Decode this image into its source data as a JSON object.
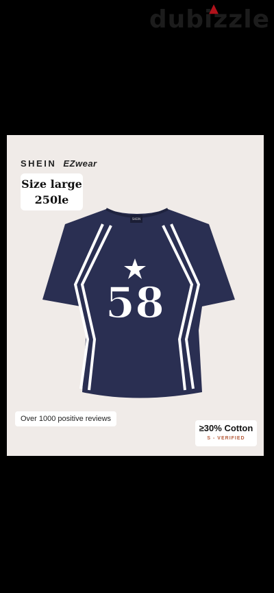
{
  "watermark": {
    "text": "dubizzle"
  },
  "product": {
    "brand": "SHEIN",
    "sub_brand": "EZwear",
    "size_text": "Size large",
    "price_text": "250le",
    "shirt_number": "58",
    "neck_label": "SHEIN",
    "colors": {
      "shirt": "#2a2f52",
      "stripe": "#ffffff",
      "background": "#f0ebe8"
    }
  },
  "badges": {
    "reviews": "Over 1000 positive reviews",
    "cotton": "≥30% Cotton",
    "verified": "S - VERIFIED"
  }
}
